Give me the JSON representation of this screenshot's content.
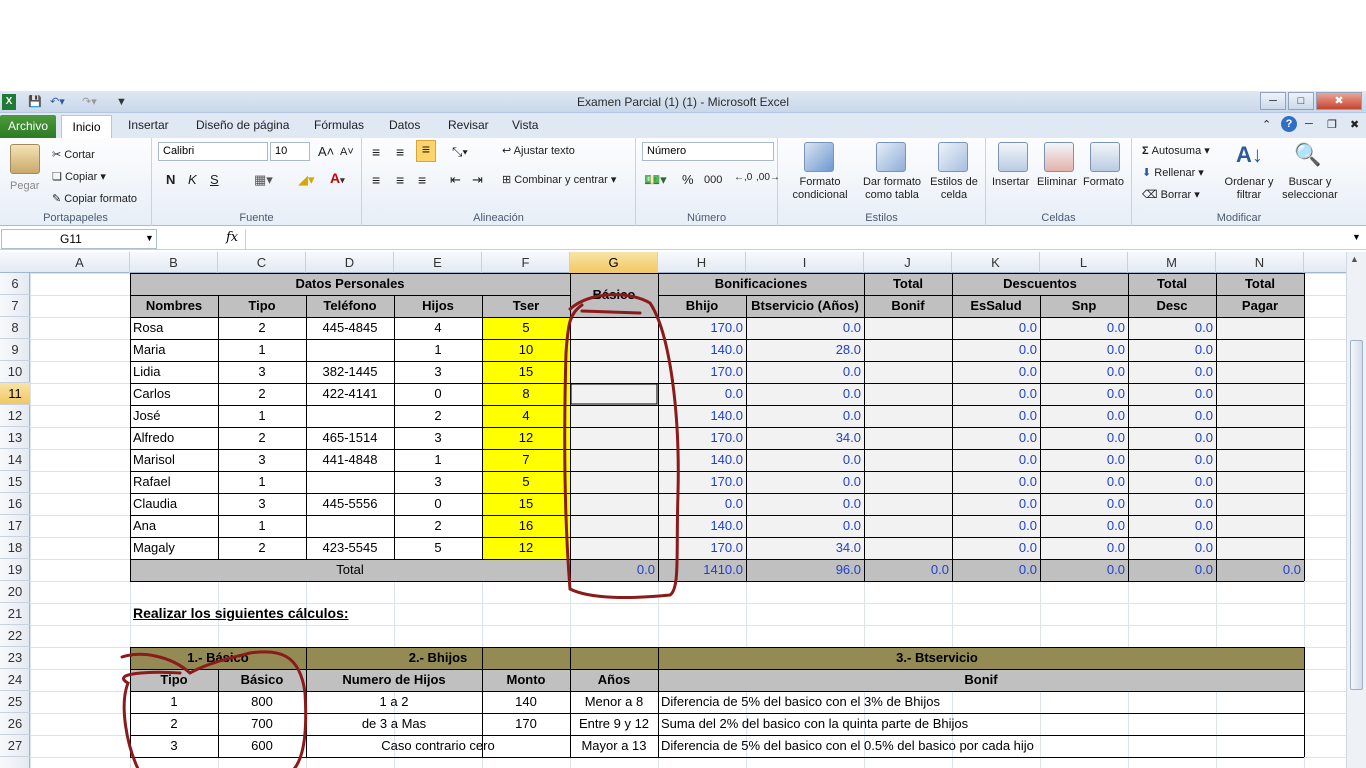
{
  "window": {
    "title": "Examen Parcial (1) (1)  -  Microsoft Excel",
    "minimize": "─",
    "maximize": "□",
    "close": "✖"
  },
  "tabs": [
    "Archivo",
    "Inicio",
    "Insertar",
    "Diseño de página",
    "Fórmulas",
    "Datos",
    "Revisar",
    "Vista"
  ],
  "ribbon": {
    "clipboard": {
      "paste": "Pegar",
      "cut": "Cortar",
      "copy": "Copiar",
      "format_painter": "Copiar formato",
      "label": "Portapapeles"
    },
    "font": {
      "name": "Calibri",
      "size": "10",
      "bold": "N",
      "italic": "K",
      "underline": "S",
      "label": "Fuente"
    },
    "alignment": {
      "wrap": "Ajustar texto",
      "merge": "Combinar y centrar",
      "label": "Alineación"
    },
    "number": {
      "format": "Número",
      "percent": "%",
      "thousands": "000",
      "label": "Número"
    },
    "styles": {
      "conditional": "Formato condicional",
      "as_table": "Dar formato como tabla",
      "cell_styles": "Estilos de celda",
      "label": "Estilos"
    },
    "cells": {
      "insert": "Insertar",
      "delete": "Eliminar",
      "format": "Formato",
      "label": "Celdas"
    },
    "editing": {
      "autosum": "Autosuma",
      "fill": "Rellenar",
      "clear": "Borrar",
      "sort": "Ordenar y filtrar",
      "find": "Buscar y seleccionar",
      "label": "Modificar"
    }
  },
  "formula_bar": {
    "name_box": "G11",
    "fx": "fx",
    "value": ""
  },
  "columns": [
    "A",
    "B",
    "C",
    "D",
    "E",
    "F",
    "G",
    "H",
    "I",
    "J",
    "K",
    "L",
    "M",
    "N"
  ],
  "selected_column": "G",
  "selected_row": "11",
  "rows": [
    "6",
    "7",
    "8",
    "9",
    "10",
    "11",
    "12",
    "13",
    "14",
    "15",
    "16",
    "17",
    "18",
    "19",
    "20",
    "21",
    "22",
    "23",
    "24",
    "25",
    "26",
    "27"
  ],
  "table1": {
    "headers_top": {
      "datos": "Datos Personales",
      "basico": "Básico",
      "bonif": "Bonificaciones",
      "total_bonif": "Total",
      "descuentos": "Descuentos",
      "total_desc": "Total",
      "total_pagar": "Total"
    },
    "headers_bottom": [
      "Nombres",
      "Tipo",
      "Teléfono",
      "Hijos",
      "Tser",
      "",
      "Bhijo",
      "Btservicio (Años)",
      "Bonif",
      "EsSalud",
      "Snp",
      "Desc",
      "Pagar"
    ],
    "rows": [
      {
        "nombre": "Rosa",
        "tipo": "2",
        "tel": "445-4845",
        "hijos": "4",
        "tser": "5",
        "bhijo": "170.0",
        "bts": "0.0",
        "es": "0.0",
        "snp": "0.0",
        "desc": "0.0"
      },
      {
        "nombre": "Maria",
        "tipo": "1",
        "tel": "",
        "hijos": "1",
        "tser": "10",
        "bhijo": "140.0",
        "bts": "28.0",
        "es": "0.0",
        "snp": "0.0",
        "desc": "0.0"
      },
      {
        "nombre": "Lidia",
        "tipo": "3",
        "tel": "382-1445",
        "hijos": "3",
        "tser": "15",
        "bhijo": "170.0",
        "bts": "0.0",
        "es": "0.0",
        "snp": "0.0",
        "desc": "0.0"
      },
      {
        "nombre": "Carlos",
        "tipo": "2",
        "tel": "422-4141",
        "hijos": "0",
        "tser": "8",
        "bhijo": "0.0",
        "bts": "0.0",
        "es": "0.0",
        "snp": "0.0",
        "desc": "0.0"
      },
      {
        "nombre": "José",
        "tipo": "1",
        "tel": "",
        "hijos": "2",
        "tser": "4",
        "bhijo": "140.0",
        "bts": "0.0",
        "es": "0.0",
        "snp": "0.0",
        "desc": "0.0"
      },
      {
        "nombre": "Alfredo",
        "tipo": "2",
        "tel": "465-1514",
        "hijos": "3",
        "tser": "12",
        "bhijo": "170.0",
        "bts": "34.0",
        "es": "0.0",
        "snp": "0.0",
        "desc": "0.0"
      },
      {
        "nombre": "Marisol",
        "tipo": "3",
        "tel": "441-4848",
        "hijos": "1",
        "tser": "7",
        "bhijo": "140.0",
        "bts": "0.0",
        "es": "0.0",
        "snp": "0.0",
        "desc": "0.0"
      },
      {
        "nombre": "Rafael",
        "tipo": "1",
        "tel": "",
        "hijos": "3",
        "tser": "5",
        "bhijo": "170.0",
        "bts": "0.0",
        "es": "0.0",
        "snp": "0.0",
        "desc": "0.0"
      },
      {
        "nombre": "Claudia",
        "tipo": "3",
        "tel": "445-5556",
        "hijos": "0",
        "tser": "15",
        "bhijo": "0.0",
        "bts": "0.0",
        "es": "0.0",
        "snp": "0.0",
        "desc": "0.0"
      },
      {
        "nombre": "Ana",
        "tipo": "1",
        "tel": "",
        "hijos": "2",
        "tser": "16",
        "bhijo": "140.0",
        "bts": "0.0",
        "es": "0.0",
        "snp": "0.0",
        "desc": "0.0"
      },
      {
        "nombre": "Magaly",
        "tipo": "2",
        "tel": "423-5545",
        "hijos": "5",
        "tser": "12",
        "bhijo": "170.0",
        "bts": "34.0",
        "es": "0.0",
        "snp": "0.0",
        "desc": "0.0"
      }
    ],
    "total": {
      "label": "Total",
      "basico": "0.0",
      "bhijo": "1410.0",
      "bts": "96.0",
      "bonif": "0.0",
      "es": "0.0",
      "snp": "0.0",
      "desc": "0.0",
      "pagar": "0.0"
    }
  },
  "instructions": "Realizar los siguientes cálculos:",
  "table2": {
    "h1": "1.- Básico",
    "h2": "2.-  Bhijos",
    "h3": "3.- Btservicio",
    "sub": [
      "Tipo",
      "Básico",
      "Numero de Hijos",
      "Monto",
      "Años",
      "Bonif"
    ],
    "rows": [
      {
        "tipo": "1",
        "basico": "800",
        "hijos": "1 a 2",
        "monto": "140",
        "anos": "Menor a 8",
        "bonif": "Diferencia de 5% del basico con el 3% de Bhijos"
      },
      {
        "tipo": "2",
        "basico": "700",
        "hijos": "de 3 a Mas",
        "monto": "170",
        "anos": "Entre 9 y 12",
        "bonif": "Suma del 2% del basico con la quinta parte de Bhijos"
      },
      {
        "tipo": "3",
        "basico": "600",
        "hijos": "Caso contrario cero",
        "monto": "",
        "anos": "Mayor a 13",
        "bonif": "Diferencia de 5% del basico con el 0.5% del basico por cada hijo"
      }
    ]
  },
  "colors": {
    "header_gray": "#c0c0c0",
    "header_olive": "#948a54",
    "yellow": "#ffff00",
    "value_blue": "#1f3fcf",
    "annotation": "#8b1a1a",
    "archivo_green": "#3a8a2e"
  }
}
